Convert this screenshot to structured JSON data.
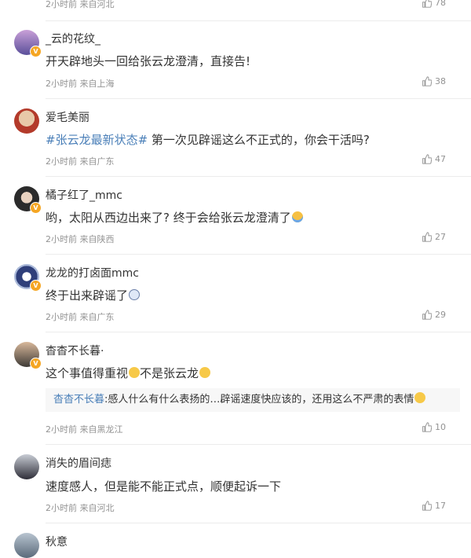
{
  "top_meta": {
    "time": "2小时前",
    "location": "来自河北",
    "likes": "78"
  },
  "comments": [
    {
      "user": "_云的花纹_",
      "text": "开天辟地头一回给张云龙澄清，直接告!",
      "time": "2小时前",
      "location": "来自上海",
      "likes": "38",
      "avatar_color": "#7a6fb0"
    },
    {
      "user": "爱毛美丽",
      "topic": "#张云龙最新状态#",
      "text": " 第一次见辟谣这么不正式的，你会干活吗?",
      "time": "2小时前",
      "location": "来自广东",
      "likes": "47",
      "avatar_color": "#c9a88a"
    },
    {
      "user": "橘子红了_mmc",
      "text": "哟，太阳从西边出来了? 终于会给张云龙澄清了",
      "time": "2小时前",
      "location": "来自陕西",
      "likes": "27",
      "avatar_color": "#3b3b3b"
    },
    {
      "user": "龙龙的打卤面mmc",
      "text": "终于出来辟谣了",
      "time": "2小时前",
      "location": "来自广东",
      "likes": "29",
      "avatar_color": "#9fb0d0"
    },
    {
      "user": "杳杳不长暮·",
      "text": "这个事值得重视",
      "text2": "不是张云龙",
      "reply_user": "杳杳不长暮",
      "reply_text": ":感人什么有什么表扬的…辟谣速度快应该的，还用这么不严肃的表情",
      "time": "2小时前",
      "location": "来自黑龙江",
      "likes": "10",
      "avatar_color": "#5a5550"
    },
    {
      "user": "消失的眉间痣",
      "text": "速度感人，但是能不能正式点，顺便起诉一下",
      "time": "2小时前",
      "location": "来自河北",
      "likes": "17",
      "avatar_color": "#4a4a55"
    },
    {
      "user": "秋意",
      "avatar_color": "#7a8ea0"
    }
  ],
  "colors": {
    "link": "#4a7fb8",
    "meta": "#939393",
    "badge": "#f5a623"
  }
}
